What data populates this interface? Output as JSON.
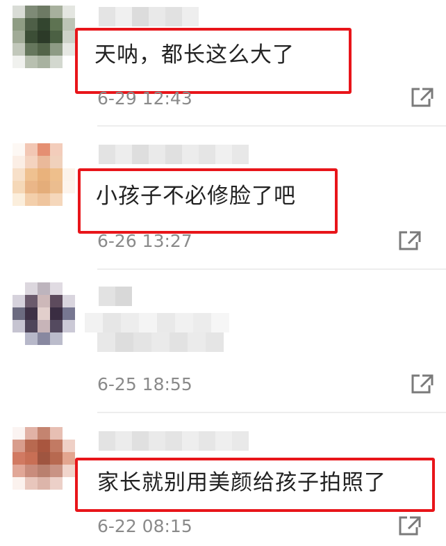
{
  "comments": [
    {
      "text": "天呐，都长这么大了",
      "time": "6-29 12:43",
      "highlighted": true
    },
    {
      "text": "小孩子不必修脸了吧",
      "time": "6-26 13:27",
      "highlighted": true
    },
    {
      "text": "",
      "time": "6-25 18:55",
      "highlighted": false
    },
    {
      "text": "家长就别用美颜给孩子拍照了",
      "time": "6-22 08:15",
      "highlighted": true
    }
  ],
  "icons": {
    "share": "share-external-icon"
  },
  "colors": {
    "highlight_border": "#e8151a",
    "timestamp": "#8a8a8a",
    "text": "#222222"
  }
}
